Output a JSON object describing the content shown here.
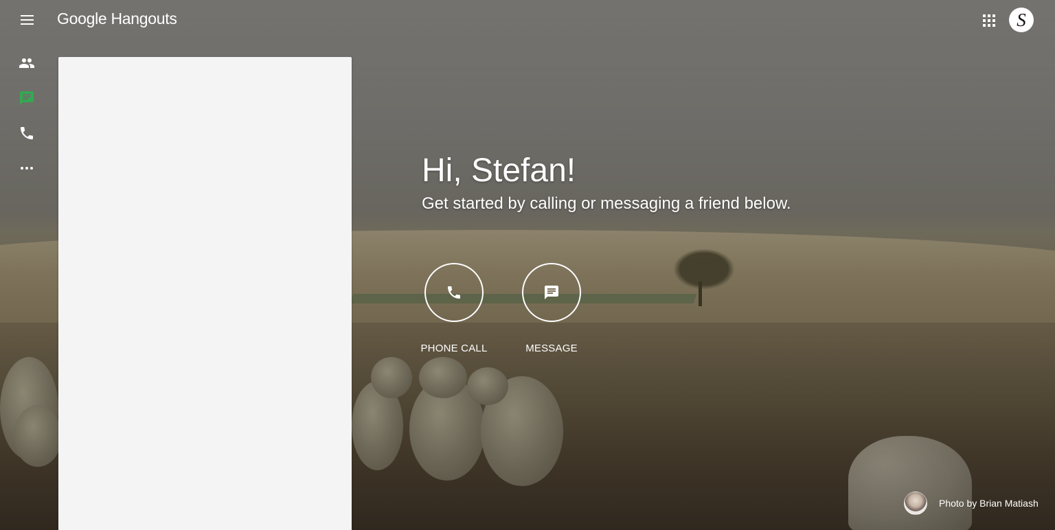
{
  "header": {
    "brand": "Google Hangouts",
    "menu_icon": "hamburger-menu-icon",
    "apps_icon": "apps-grid-icon",
    "avatar_letter": "S"
  },
  "rail": {
    "items": [
      {
        "name": "contacts",
        "icon": "people-icon",
        "active": false
      },
      {
        "name": "conversations",
        "icon": "chat-bubble-icon",
        "active": true
      },
      {
        "name": "phone-calls",
        "icon": "phone-icon",
        "active": false
      },
      {
        "name": "more",
        "icon": "more-horizontal-icon",
        "active": false
      }
    ],
    "active_color": "#34a853"
  },
  "welcome": {
    "greeting": "Hi, Stefan!",
    "subtitle": "Get started by calling or messaging a friend below."
  },
  "actions": [
    {
      "label": "PHONE CALL",
      "icon": "phone-icon"
    },
    {
      "label": "MESSAGE",
      "icon": "message-icon"
    }
  ],
  "credit": {
    "text": "Photo by Brian Matiash"
  }
}
